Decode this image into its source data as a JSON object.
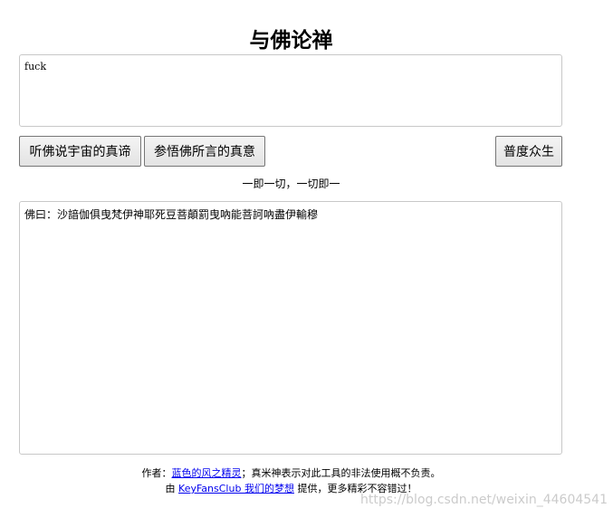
{
  "page": {
    "title": "与佛论禅"
  },
  "input": {
    "value": "fuck"
  },
  "buttons": {
    "encode_label": "听佛说宇宙的真谛",
    "decode_label": "参悟佛所言的真意",
    "share_label": "普度众生"
  },
  "motto": "一即一切，一切即一",
  "output": {
    "text": "佛曰：沙諳伽俱曳梵伊神耶死豆菩顛罰曳吶能菩訶吶盡伊輸穆"
  },
  "footer": {
    "line1_prefix": "作者：",
    "author_link": "蓝色的风之精灵",
    "line1_suffix": "；真米神表示对此工具的非法使用概不负责。",
    "line2_prefix": "由 ",
    "host_link": "KeyFansClub 我们的梦想",
    "line2_suffix": " 提供，更多精彩不容错过！"
  },
  "watermark": "https://blog.csdn.net/weixin_44604541"
}
